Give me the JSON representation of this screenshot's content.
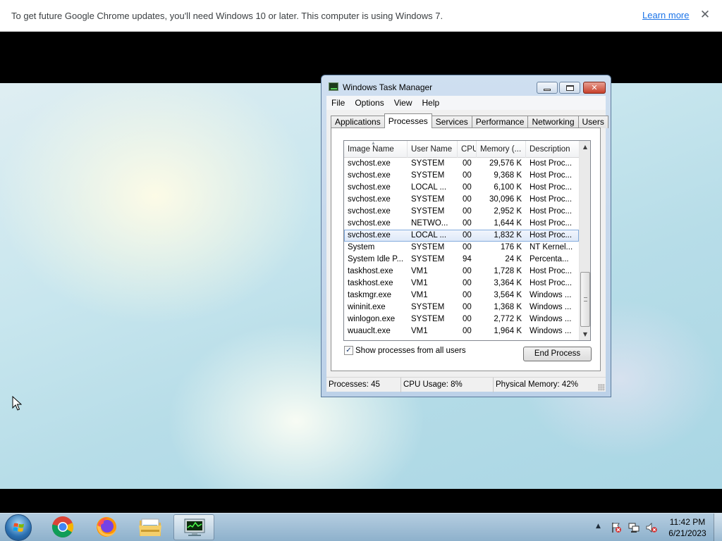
{
  "infobar": {
    "message": "To get future Google Chrome updates, you'll need Windows 10 or later. This computer is using Windows 7.",
    "link": "Learn more",
    "close": "✕"
  },
  "task_manager": {
    "title": "Windows Task Manager",
    "menu": [
      "File",
      "Options",
      "View",
      "Help"
    ],
    "tabs": [
      "Applications",
      "Processes",
      "Services",
      "Performance",
      "Networking",
      "Users"
    ],
    "active_tab": "Processes",
    "columns": [
      "Image Name",
      "User Name",
      "CPU",
      "Memory (...",
      "Description"
    ],
    "rows": [
      {
        "name": "svchost.exe",
        "user": "SYSTEM",
        "cpu": "00",
        "mem": "29,576 K",
        "desc": "Host Proc..."
      },
      {
        "name": "svchost.exe",
        "user": "SYSTEM",
        "cpu": "00",
        "mem": "9,368 K",
        "desc": "Host Proc..."
      },
      {
        "name": "svchost.exe",
        "user": "LOCAL ...",
        "cpu": "00",
        "mem": "6,100 K",
        "desc": "Host Proc..."
      },
      {
        "name": "svchost.exe",
        "user": "SYSTEM",
        "cpu": "00",
        "mem": "30,096 K",
        "desc": "Host Proc..."
      },
      {
        "name": "svchost.exe",
        "user": "SYSTEM",
        "cpu": "00",
        "mem": "2,952 K",
        "desc": "Host Proc..."
      },
      {
        "name": "svchost.exe",
        "user": "NETWO...",
        "cpu": "00",
        "mem": "1,644 K",
        "desc": "Host Proc..."
      },
      {
        "name": "svchost.exe",
        "user": "LOCAL ...",
        "cpu": "00",
        "mem": "1,832 K",
        "desc": "Host Proc...",
        "selected": true
      },
      {
        "name": "System",
        "user": "SYSTEM",
        "cpu": "00",
        "mem": "176 K",
        "desc": "NT Kernel..."
      },
      {
        "name": "System Idle P...",
        "user": "SYSTEM",
        "cpu": "94",
        "mem": "24 K",
        "desc": "Percenta..."
      },
      {
        "name": "taskhost.exe",
        "user": "VM1",
        "cpu": "00",
        "mem": "1,728 K",
        "desc": "Host Proc..."
      },
      {
        "name": "taskhost.exe",
        "user": "VM1",
        "cpu": "00",
        "mem": "3,364 K",
        "desc": "Host Proc..."
      },
      {
        "name": "taskmgr.exe",
        "user": "VM1",
        "cpu": "00",
        "mem": "3,564 K",
        "desc": "Windows ..."
      },
      {
        "name": "wininit.exe",
        "user": "SYSTEM",
        "cpu": "00",
        "mem": "1,368 K",
        "desc": "Windows ..."
      },
      {
        "name": "winlogon.exe",
        "user": "SYSTEM",
        "cpu": "00",
        "mem": "2,772 K",
        "desc": "Windows ..."
      },
      {
        "name": "wuauclt.exe",
        "user": "VM1",
        "cpu": "00",
        "mem": "1,964 K",
        "desc": "Windows ..."
      }
    ],
    "show_all_label": "Show processes from all users",
    "show_all_checked": true,
    "end_process_label": "End Process",
    "status": {
      "processes": "Processes: 45",
      "cpu": "CPU Usage: 8%",
      "memory": "Physical Memory: 42%"
    }
  },
  "taskbar": {
    "apps": [
      "chrome-icon",
      "firefox-icon",
      "file-explorer-icon",
      "task-manager-icon"
    ],
    "active_app": "task-manager-icon",
    "clock_time": "11:42 PM",
    "clock_date": "6/21/2023",
    "tray_arrow": "▲"
  }
}
